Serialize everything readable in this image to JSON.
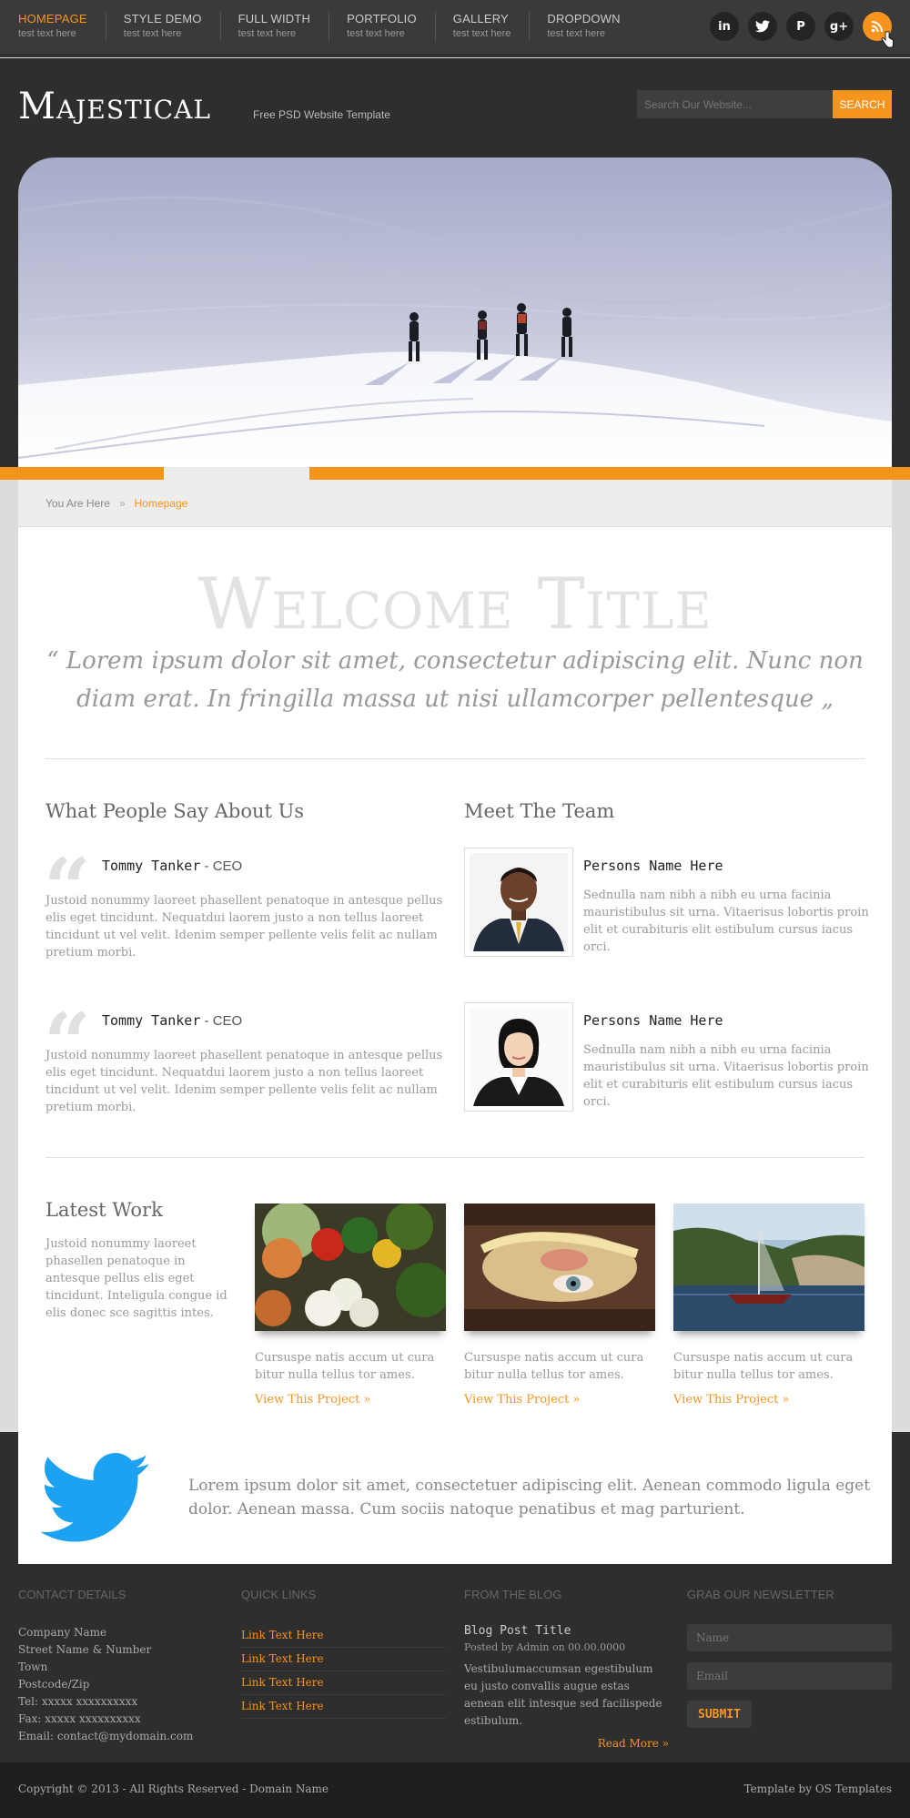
{
  "nav": [
    {
      "label": "HOMEPAGE",
      "sub": "test text here"
    },
    {
      "label": "STYLE DEMO",
      "sub": "test text here"
    },
    {
      "label": "FULL WIDTH",
      "sub": "test text here"
    },
    {
      "label": "PORTFOLIO",
      "sub": "test text here"
    },
    {
      "label": "GALLERY",
      "sub": "test text here"
    },
    {
      "label": "DROPDOWN",
      "sub": "test text here"
    }
  ],
  "social": [
    {
      "icon": "linkedin-icon",
      "glyph": "in"
    },
    {
      "icon": "twitter-icon",
      "glyph": "t"
    },
    {
      "icon": "pinterest-icon",
      "glyph": "P"
    },
    {
      "icon": "google-plus-icon",
      "glyph": "g+"
    },
    {
      "icon": "rss-icon",
      "glyph": ")"
    }
  ],
  "header": {
    "logo": "Majestical",
    "tagline": "Free PSD Website Template",
    "search_placeholder": "Search Our Website...",
    "search_button": "SEARCH"
  },
  "breadcrumb": {
    "label": "You Are Here",
    "separator": "»",
    "current": "Homepage"
  },
  "intro": {
    "title": "Welcome Title",
    "quote": "“ Lorem ipsum dolor sit amet, consectetur adipiscing elit. Nunc non diam erat. In fringilla massa ut nisi ullamcorper pellentesque „"
  },
  "testimonials": {
    "title": "What People Say About Us",
    "items": [
      {
        "name": "Tommy Tanker",
        "role": " - CEO",
        "text": "Justoid nonummy laoreet phasellent penatoque in antesque pellus elis eget tincidunt. Nequatdui laorem justo a non tellus laoreet tincidunt ut vel velit. Idenim semper pellente velis felit ac nullam pretium morbi."
      },
      {
        "name": "Tommy Tanker",
        "role": " - CEO",
        "text": "Justoid nonummy laoreet phasellent penatoque in antesque pellus elis eget tincidunt. Nequatdui laorem justo a non tellus laoreet tincidunt ut vel velit. Idenim semper pellente velis felit ac nullam pretium morbi."
      }
    ]
  },
  "team": {
    "title": "Meet The Team",
    "members": [
      {
        "name": "Persons Name Here",
        "text": "Sednulla nam nibh a nibh eu urna facinia mauristibulus sit urna. Vitaerisus lobortis proin elit et curabituris elit estibulum cursus iacus orci."
      },
      {
        "name": "Persons Name Here",
        "text": "Sednulla nam nibh a nibh eu urna facinia mauristibulus sit urna. Vitaerisus lobortis proin elit et curabituris elit estibulum cursus iacus orci."
      }
    ]
  },
  "latest_work": {
    "title": "Latest Work",
    "text": "Justoid nonummy laoreet phasellen penatoque in antesque pellus elis eget tincidunt. Inteligula congue id elis donec sce sagittis intes.",
    "items": [
      {
        "text": "Cursuspe natis accum ut cura bitur nulla tellus tor ames.",
        "link": "View This Project »"
      },
      {
        "text": "Cursuspe natis accum ut cura bitur nulla tellus tor ames.",
        "link": "View This Project »"
      },
      {
        "text": "Cursuspe natis accum ut cura bitur nulla tellus tor ames.",
        "link": "View This Project »"
      }
    ]
  },
  "twitter": {
    "text": "Lorem ipsum dolor sit amet, consectetuer adipiscing elit. Aenean commodo ligula eget dolor. Aenean massa. Cum sociis natoque penatibus et mag parturient."
  },
  "footer": {
    "contact": {
      "title": "CONTACT DETAILS",
      "lines": [
        "Company Name",
        "Street Name & Number",
        "Town",
        "Postcode/Zip",
        "Tel: xxxxx xxxxxxxxxx",
        "Fax: xxxxx xxxxxxxxxx",
        "Email: contact@mydomain.com"
      ]
    },
    "links": {
      "title": "QUICK LINKS",
      "items": [
        "Link Text Here",
        "Link Text Here",
        "Link Text Here",
        "Link Text Here"
      ]
    },
    "blog": {
      "title": "FROM THE BLOG",
      "post_title": "Blog Post Title",
      "meta": "Posted by Admin on 00.00.0000",
      "text": "Vestibulumaccumsan egestibulum eu justo convallis augue estas aenean elit intesque sed facilispede estibulum.",
      "more": "Read More »"
    },
    "newsletter": {
      "title": "GRAB OUR NEWSLETTER",
      "name_placeholder": "Name",
      "email_placeholder": "Email",
      "submit": "SUBMIT"
    }
  },
  "bottom": {
    "copyright": "Copyright © 2013 - All Rights Reserved - Domain Name",
    "credit": "Template by OS Templates"
  },
  "colors": {
    "accent": "#f7941d",
    "dark": "#2e2e2e",
    "twitter": "#1da1f2"
  }
}
